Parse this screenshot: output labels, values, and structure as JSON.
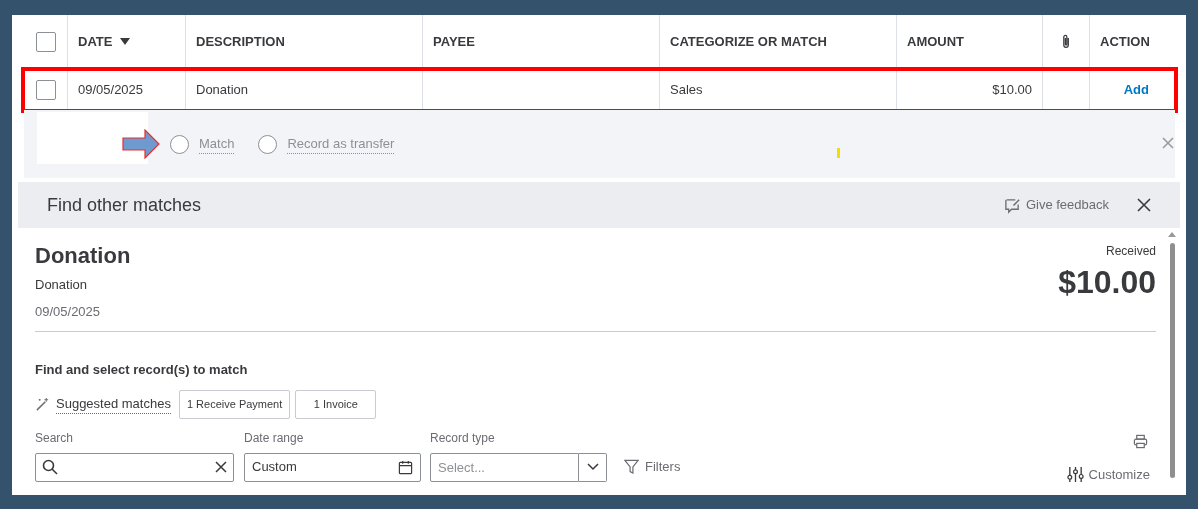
{
  "table": {
    "columns": [
      {
        "label": "DATE",
        "sorted": true
      },
      {
        "label": "DESCRIPTION",
        "sorted": false
      },
      {
        "label": "PAYEE",
        "sorted": false
      },
      {
        "label": "CATEGORIZE OR MATCH",
        "sorted": false
      },
      {
        "label": "AMOUNT",
        "sorted": false
      },
      {
        "kind": "attachment"
      },
      {
        "label": "ACTION",
        "sorted": false
      }
    ],
    "header_checked": false,
    "rows": [
      {
        "checked": false,
        "highlighted": true,
        "date": "09/05/2025",
        "description": "Donation",
        "category": "Sales",
        "amount": "$10.00",
        "action": "Add"
      }
    ]
  },
  "options": [
    {
      "label": "Match",
      "selected": false
    },
    {
      "label": "Record as transfer",
      "selected": false
    }
  ],
  "panel": {
    "title": "Find other matches",
    "feedback": "Give feedback",
    "name": "Donation",
    "description": "Donation",
    "date": "09/05/2025",
    "status": "Received",
    "amount": "$10.00",
    "find_heading": "Find and select record(s) to match",
    "suggested": "Suggested matches",
    "chips": [
      "1 Receive Payment",
      "1 Invoice"
    ],
    "search": {
      "label": "Search"
    },
    "date_range": {
      "label": "Date range",
      "value": "Custom"
    },
    "record_type": {
      "label": "Record type",
      "placeholder": "Select..."
    },
    "filters": "Filters",
    "customize": "Customize"
  }
}
